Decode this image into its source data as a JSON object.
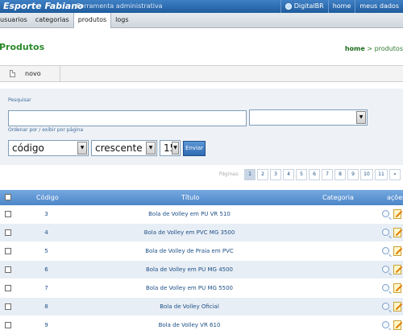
{
  "header": {
    "brand": "Esporte Fabiano",
    "subtitle": "Ferramenta administrativa",
    "links": [
      {
        "label": "DigitalBR"
      },
      {
        "label": "home"
      },
      {
        "label": "meus dados"
      }
    ]
  },
  "nav": {
    "tabs": [
      {
        "label": "usuarios",
        "active": false
      },
      {
        "label": "categorias",
        "active": false
      },
      {
        "label": "produtos",
        "active": true
      },
      {
        "label": "logs",
        "active": false
      }
    ]
  },
  "page": {
    "title": "Produtos",
    "breadcrumb": {
      "home": "home",
      "separator": ">",
      "current": "produtos"
    }
  },
  "toolbar": {
    "new_label": "novo"
  },
  "search": {
    "label": "Pesquisar",
    "query_value": "",
    "field_select_value": "",
    "order_label": "Ordenar por / exibir por página",
    "order_by": "código",
    "direction": "crescente",
    "per_page": "15",
    "submit_label": "Enviar"
  },
  "pagination": {
    "label": "Páginas:",
    "pages": [
      "1",
      "2",
      "3",
      "4",
      "5",
      "6",
      "7",
      "8",
      "9",
      "10",
      "11",
      "»"
    ],
    "current": "1"
  },
  "table": {
    "columns": {
      "code": "Código",
      "title": "Título",
      "category": "Categoria",
      "actions": "ações"
    },
    "rows": [
      {
        "code": "3",
        "title": "Bola de Volley em PU VR 510",
        "category": ""
      },
      {
        "code": "4",
        "title": "Bola de Volley em PVC MG 3500",
        "category": ""
      },
      {
        "code": "5",
        "title": "Bola de Volley de Praia em PVC",
        "category": ""
      },
      {
        "code": "6",
        "title": "Bola de Volley em PU MG 4500",
        "category": ""
      },
      {
        "code": "7",
        "title": "Bola de Volley em PU MG 5500",
        "category": ""
      },
      {
        "code": "8",
        "title": "Bola de Volley Oficial",
        "category": ""
      },
      {
        "code": "9",
        "title": "Bola de Volley VR 610",
        "category": ""
      }
    ]
  }
}
